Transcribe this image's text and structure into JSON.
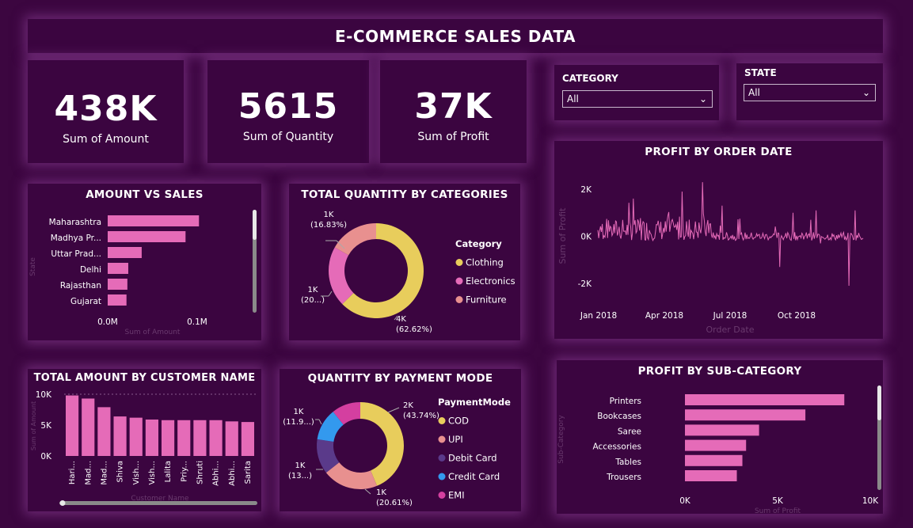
{
  "header": {
    "title": "E-COMMERCE SALES DATA"
  },
  "kpis": [
    {
      "value": "438K",
      "label": "Sum of Amount"
    },
    {
      "value": "5615",
      "label": "Sum of Quantity"
    },
    {
      "value": "37K",
      "label": "Sum of Profit"
    }
  ],
  "slicers": {
    "category": {
      "label": "CATEGORY",
      "value": "All"
    },
    "state": {
      "label": "STATE",
      "value": "All"
    }
  },
  "colors": {
    "bar": "#e56bb8",
    "clothing": "#e8cd5c",
    "electronics": "#e56bb8",
    "furniture": "#e8908f",
    "cod": "#e8cd5c",
    "upi": "#e8908f",
    "debit_card": "#5a3a8a",
    "credit_card": "#3399ee",
    "emi": "#d43fa0"
  },
  "chart_data": [
    {
      "id": "amount_vs_sales",
      "type": "bar",
      "orientation": "horizontal",
      "title": "AMOUNT VS SALES",
      "xlabel": "Sum of Amount",
      "ylabel": "State",
      "categories": [
        "Maharashtra",
        "Madhya Pr...",
        "Uttar Prad...",
        "Delhi",
        "Rajasthan",
        "Gujarat"
      ],
      "values": [
        102000,
        87000,
        38000,
        23000,
        22000,
        21000
      ],
      "xticks": [
        "0.0M",
        "0.1M"
      ],
      "xlim": [
        0,
        100000
      ]
    },
    {
      "id": "quantity_by_category",
      "type": "pie",
      "donut": true,
      "title": "TOTAL QUANTITY BY CATEGORIES",
      "legend_title": "Category",
      "legend": "right",
      "slices": [
        {
          "name": "Clothing",
          "value": 62.62,
          "label": "4K",
          "pct": "(62.62%)"
        },
        {
          "name": "Electronics",
          "value": 20.55,
          "label": "1K",
          "pct": "(20...)"
        },
        {
          "name": "Furniture",
          "value": 16.83,
          "label": "1K",
          "pct": "(16.83%)"
        }
      ]
    },
    {
      "id": "profit_by_order_date",
      "type": "line",
      "title": "PROFIT BY ORDER DATE",
      "xlabel": "Order Date",
      "ylabel": "Sum of Profit",
      "yticks": [
        "2K",
        "0K",
        "-2K"
      ],
      "xticks": [
        "Jan 2018",
        "Apr 2018",
        "Jul 2018",
        "Oct 2018"
      ],
      "ylim": [
        -2000,
        2000
      ]
    },
    {
      "id": "amount_by_customer",
      "type": "bar",
      "title": "TOTAL AMOUNT BY CUSTOMER NAME",
      "xlabel": "Customer Name",
      "ylabel": "Sum of Amount",
      "categories": [
        "Hari...",
        "Mad...",
        "Mad...",
        "Shiva",
        "Vish...",
        "Vish...",
        "Lalita",
        "Priy...",
        "Shruti",
        "Abhi...",
        "Abhi...",
        "Sarita"
      ],
      "values": [
        9800,
        9300,
        7900,
        6400,
        6200,
        5900,
        5800,
        5800,
        5800,
        5800,
        5600,
        5500
      ],
      "yticks": [
        "10K",
        "5K",
        "0K"
      ],
      "ylim": [
        0,
        10000
      ]
    },
    {
      "id": "quantity_by_payment",
      "type": "pie",
      "donut": true,
      "title": "QUANTITY BY PAYMENT MODE",
      "legend_title": "PaymentMode",
      "legend": "right",
      "slices": [
        {
          "name": "COD",
          "value": 43.74,
          "label": "2K",
          "pct": "(43.74%)"
        },
        {
          "name": "UPI",
          "value": 20.61,
          "label": "1K",
          "pct": "(20.61%)"
        },
        {
          "name": "Debit Card",
          "value": 13.0,
          "label": "1K",
          "pct": "(13...)"
        },
        {
          "name": "Credit Card",
          "value": 11.9,
          "label": "1K",
          "pct": "(11.9...)"
        },
        {
          "name": "EMI",
          "value": 10.75,
          "label": "",
          "pct": ""
        }
      ]
    },
    {
      "id": "profit_by_subcategory",
      "type": "bar",
      "orientation": "horizontal",
      "title": "PROFIT BY SUB-CATEGORY",
      "xlabel": "Sum of Profit",
      "ylabel": "Sub-Category",
      "categories": [
        "Printers",
        "Bookcases",
        "Saree",
        "Accessories",
        "Tables",
        "Trousers"
      ],
      "values": [
        8600,
        6500,
        4000,
        3300,
        3100,
        2800
      ],
      "xticks": [
        "0K",
        "5K",
        "10K"
      ],
      "xlim": [
        0,
        10000
      ]
    }
  ]
}
